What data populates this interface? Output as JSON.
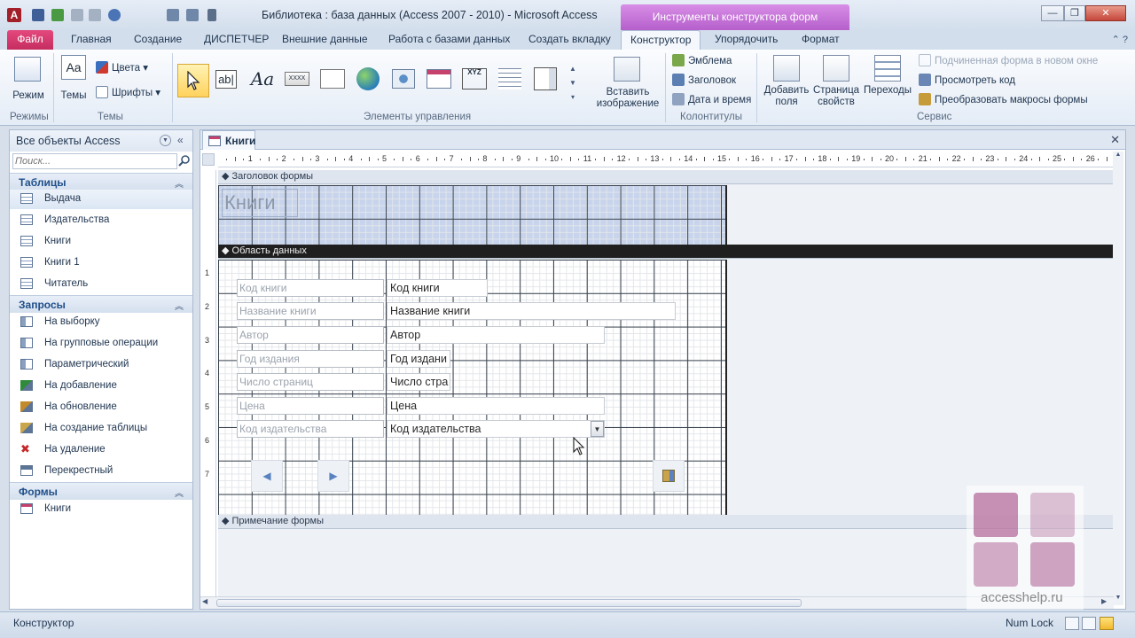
{
  "window": {
    "title": "Библиотека : база данных (Access 2007 - 2010) - Microsoft Access",
    "contextual_tab_title": "Инструменты конструктора форм",
    "app_icon_letter": "A",
    "minimize_glyph": "—",
    "maximize_glyph": "❐",
    "close_glyph": "✕",
    "help_glyphs": "⌃ ?"
  },
  "ribbon": {
    "tabs": [
      {
        "label": "Файл"
      },
      {
        "label": "Главная"
      },
      {
        "label": "Создание"
      },
      {
        "label": "ДИСПЕТЧЕР"
      },
      {
        "label": "Внешние данные"
      },
      {
        "label": "Работа с базами данных"
      },
      {
        "label": "Создать вкладку"
      },
      {
        "label": "Конструктор"
      },
      {
        "label": "Упорядочить"
      },
      {
        "label": "Формат"
      }
    ],
    "active_tab": "Конструктор",
    "groups": {
      "modes": {
        "label": "Режимы",
        "view_button": "Режим"
      },
      "themes": {
        "label": "Темы",
        "themes_button": "Темы",
        "colors": "Цвета",
        "fonts": "Шрифты"
      },
      "controls": {
        "label": "Элементы управления",
        "insert_image": "Вставить изображение",
        "label_glyph": "Aa",
        "textbox_glyph": "ab|",
        "xyz_glyph": "XYZ"
      },
      "header_footer": {
        "label": "Колонтитулы",
        "logo": "Эмблема",
        "title": "Заголовок",
        "date_time": "Дата и время"
      },
      "tools": {
        "label": "Сервис",
        "add_fields": "Добавить поля",
        "property_sheet": "Страница свойств",
        "tab_order": "Переходы",
        "subform_new_window": "Подчиненная форма в новом окне",
        "view_code": "Просмотреть код",
        "convert_macros": "Преобразовать макросы формы"
      }
    }
  },
  "nav": {
    "title": "Все объекты Access",
    "search_placeholder": "Поиск...",
    "sections": {
      "tables": {
        "title": "Таблицы",
        "items": [
          "Выдача",
          "Издательства",
          "Книги",
          "Книги 1",
          "Читатель"
        ]
      },
      "queries": {
        "title": "Запросы",
        "items": [
          "На выборку",
          "На групповые операции",
          "Параметрический",
          "На добавление",
          "На обновление",
          "На создание таблицы",
          "На удаление",
          "Перекрестный"
        ]
      },
      "forms": {
        "title": "Формы",
        "items": [
          "Книги"
        ]
      }
    }
  },
  "document": {
    "tab_label": "Книги",
    "close_glyph": "✕",
    "sections": {
      "header": "Заголовок формы",
      "detail": "Область данных",
      "footer": "Примечание формы"
    },
    "form_title": "Книги",
    "fields": [
      {
        "label": "Код книги",
        "control": "Код книги"
      },
      {
        "label": "Название книги",
        "control": "Название книги"
      },
      {
        "label": "Автор",
        "control": "Автор"
      },
      {
        "label": "Год издания",
        "control": "Год издани"
      },
      {
        "label": "Число страниц",
        "control": "Число стра"
      },
      {
        "label": "Цена",
        "control": "Цена"
      },
      {
        "label": "Код издательства",
        "control": "Код издательства"
      }
    ],
    "combo_arrow_glyph": "▼",
    "prev_glyph": "◀",
    "next_glyph": "▶",
    "ruler_numbers": [
      "1",
      "2",
      "3",
      "4",
      "5",
      "6",
      "7",
      "8",
      "9",
      "10",
      "11",
      "12",
      "13",
      "14",
      "15",
      "16",
      "17",
      "18",
      "19",
      "20",
      "21",
      "22",
      "23",
      "24",
      "25",
      "26"
    ],
    "vruler_numbers": [
      "1",
      "2",
      "3",
      "4",
      "5",
      "6",
      "7"
    ]
  },
  "watermark": {
    "text": "accesshelp.ru"
  },
  "status": {
    "left": "Конструктор",
    "numlock": "Num Lock"
  },
  "colors": {
    "file_tab": "#c52d60",
    "contextual": "#b55fcc",
    "section_active": "#1f1f1f",
    "header_grid": "#c7d4ec"
  }
}
